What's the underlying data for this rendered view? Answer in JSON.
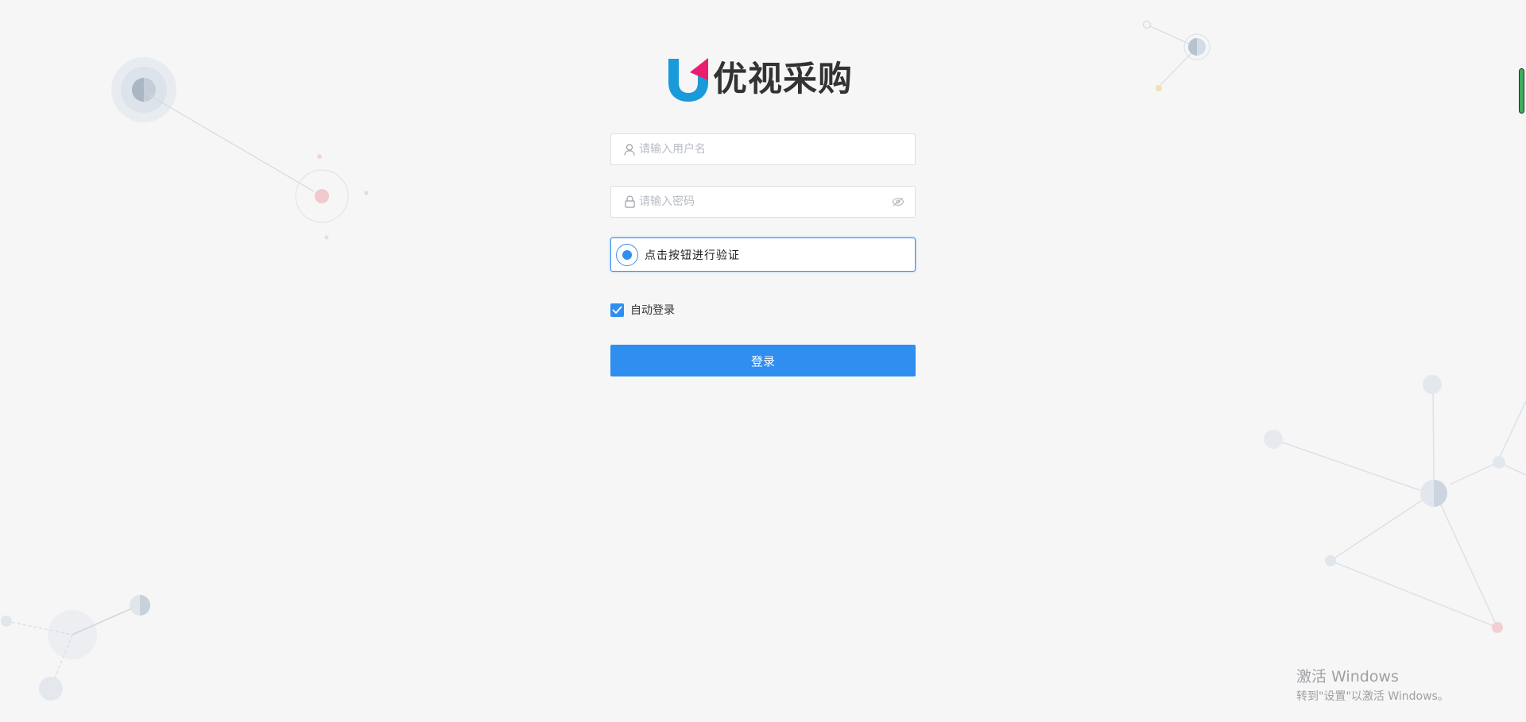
{
  "brand": {
    "name": "优视采购",
    "colors": {
      "blue": "#1a9ad9",
      "pink": "#ec1c6e"
    }
  },
  "login": {
    "username_placeholder": "请输入用户名",
    "password_placeholder": "请输入密码",
    "verify_text": "点击按钮进行验证",
    "auto_login_label": "自动登录",
    "auto_login_checked": true,
    "submit_label": "登录"
  },
  "icons": {
    "username": "user-icon",
    "password": "lock-icon",
    "toggle_password": "eye-icon",
    "verify": "radio-dot-icon",
    "checkbox": "check-icon"
  },
  "theme": {
    "primary": "#2f8ef0",
    "background": "#f6f6f6",
    "scrollbar_thumb": "#3fae5e"
  },
  "watermark": {
    "title": "激活 Windows",
    "subtitle": "转到\"设置\"以激活 Windows。"
  }
}
